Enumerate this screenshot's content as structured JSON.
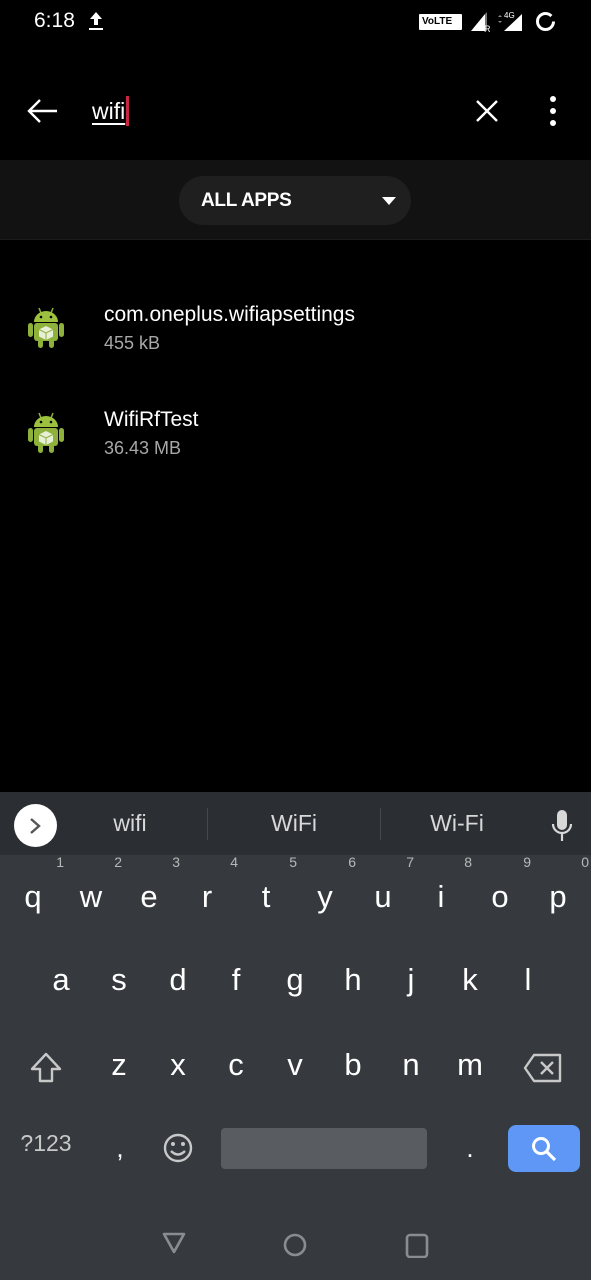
{
  "status_bar": {
    "time": "6:18",
    "volte_label": "VoLTE",
    "network_label": "4G",
    "roaming_label": "R",
    "icons": [
      "upload-icon",
      "volte-icon",
      "signal-roaming-icon",
      "signal-4g-icon",
      "battery-ring-icon"
    ]
  },
  "search": {
    "value": "wifi",
    "back_icon": "arrow-left-icon",
    "clear_icon": "close-icon",
    "more_icon": "more-vert-icon"
  },
  "filter": {
    "selected": "ALL APPS",
    "icon": "dropdown-triangle-icon"
  },
  "apps": [
    {
      "name": "com.oneplus.wifiapsettings",
      "size": "455 kB",
      "icon": "android-icon"
    },
    {
      "name": "WifiRfTest",
      "size": "36.43 MB",
      "icon": "android-icon"
    }
  ],
  "keyboard": {
    "suggestions": [
      "wifi",
      "WiFi",
      "Wi-Fi"
    ],
    "row1": [
      {
        "k": "q",
        "h": "1"
      },
      {
        "k": "w",
        "h": "2"
      },
      {
        "k": "e",
        "h": "3"
      },
      {
        "k": "r",
        "h": "4"
      },
      {
        "k": "t",
        "h": "5"
      },
      {
        "k": "y",
        "h": "6"
      },
      {
        "k": "u",
        "h": "7"
      },
      {
        "k": "i",
        "h": "8"
      },
      {
        "k": "o",
        "h": "9"
      },
      {
        "k": "p",
        "h": "0"
      }
    ],
    "row2": [
      "a",
      "s",
      "d",
      "f",
      "g",
      "h",
      "j",
      "k",
      "l"
    ],
    "row3": [
      "z",
      "x",
      "c",
      "v",
      "b",
      "n",
      "m"
    ],
    "symbols_label": "?123",
    "comma_label": ",",
    "period_label": ".",
    "accent_color": "#5e97f6"
  },
  "nav": {
    "icons": [
      "back-triangle-icon",
      "home-circle-icon",
      "recents-square-icon"
    ]
  }
}
